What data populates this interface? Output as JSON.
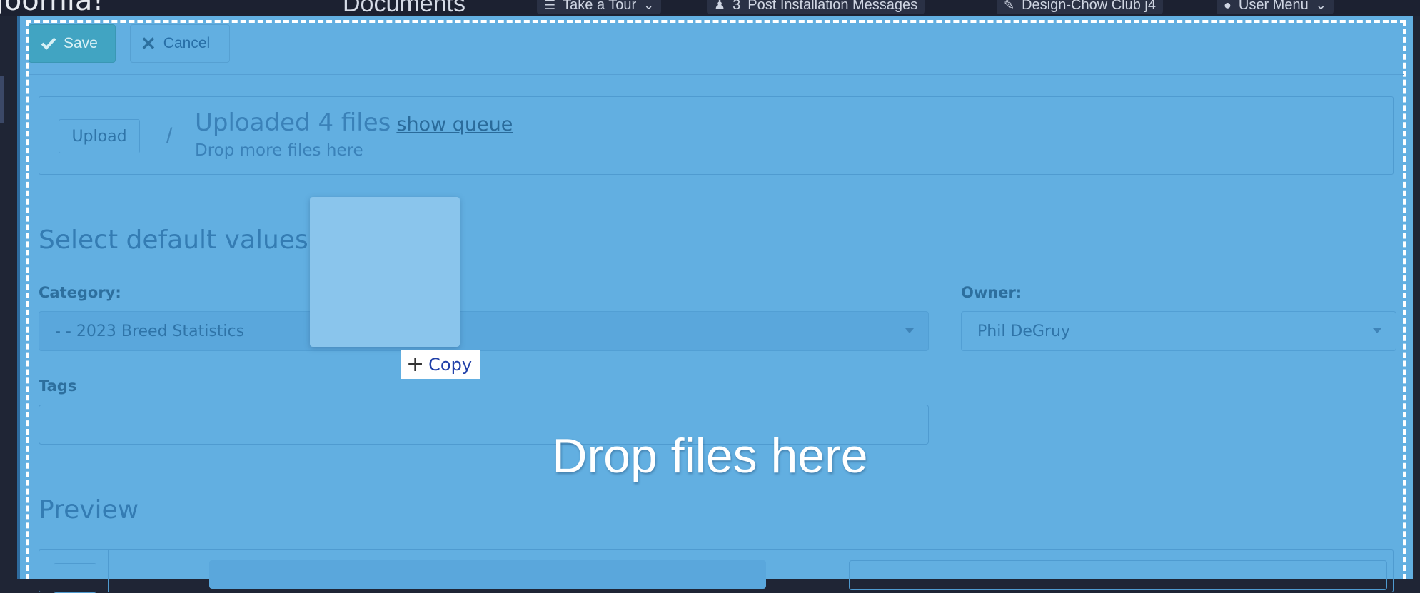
{
  "topbar": {
    "logo_text": "Joomla!",
    "page_title": "Documents",
    "tour_label": "Take a Tour",
    "notif_count": "3",
    "post_install_label": "Post Installation Messages",
    "site_label": "Design-Chow Club j4",
    "user_menu_label": "User Menu"
  },
  "toolbar": {
    "save_label": "Save",
    "cancel_label": "Cancel"
  },
  "upload": {
    "button_label": "Upload",
    "separator": "/",
    "status": "Uploaded 4 files",
    "queue_link": "show queue",
    "hint": "Drop more files here"
  },
  "defaults": {
    "heading": "Select default values",
    "category_label": "Category:",
    "category_value": "- - 2023 Breed Statistics",
    "owner_label": "Owner:",
    "owner_value": "Phil DeGruy",
    "tags_label": "Tags"
  },
  "preview": {
    "heading": "Preview"
  },
  "drag": {
    "copy_label": "Copy"
  },
  "drop_message": "Drop files here",
  "colors": {
    "overlay": "#62afe1",
    "dash_border": "#ffffff",
    "save_button": "#41a4c2",
    "topbar": "#1c2131"
  }
}
